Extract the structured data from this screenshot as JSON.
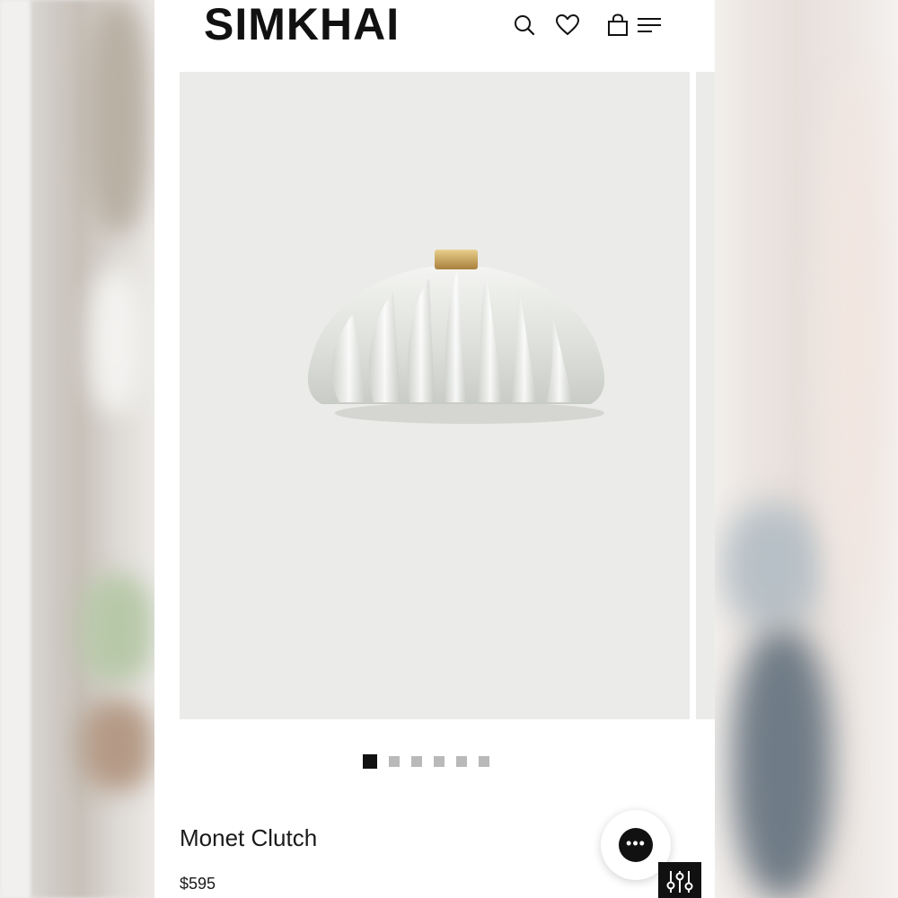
{
  "header": {
    "logo": "SIMKHAI",
    "icons": [
      "search-icon",
      "heart-icon",
      "bag-icon",
      "menu-icon"
    ]
  },
  "gallery": {
    "image_count": 6,
    "active_index": 0
  },
  "product": {
    "name": "Monet Clutch",
    "price": "$595"
  },
  "colors": {
    "brand": "#111111",
    "background": "#ffffff",
    "gallery_bg": "#ebebe9",
    "dot_inactive": "#b9b9b9"
  }
}
